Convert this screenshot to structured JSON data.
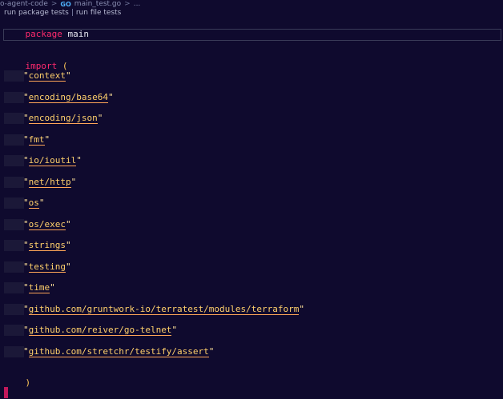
{
  "breadcrumb": {
    "folder": "o-agent-code",
    "separator": ">",
    "file_icon": "go-file-icon",
    "file_icon_glyph": "GO",
    "file": "main_test.go",
    "more": "..."
  },
  "codelens": {
    "run_package_tests": "run package tests",
    "separator": "|",
    "run_file_tests": "run file tests"
  },
  "code": {
    "package_keyword": "package",
    "package_name": "main",
    "import_keyword": "import",
    "open_paren": "(",
    "close_paren": ")",
    "imports": [
      "context",
      "encoding/base64",
      "encoding/json",
      "fmt",
      "io/ioutil",
      "net/http",
      "os",
      "os/exec",
      "strings",
      "testing",
      "time",
      "github.com/gruntwork-io/terratest/modules/terraform",
      "github.com/reiver/go-telnet",
      "github.com/stretchr/testify/assert"
    ]
  },
  "colors": {
    "background": "#0f0a2e",
    "keyword": "#ff2a6d",
    "string": "#ffd06b",
    "string_underline": "#ffa657",
    "cursor": "#c2185b"
  }
}
